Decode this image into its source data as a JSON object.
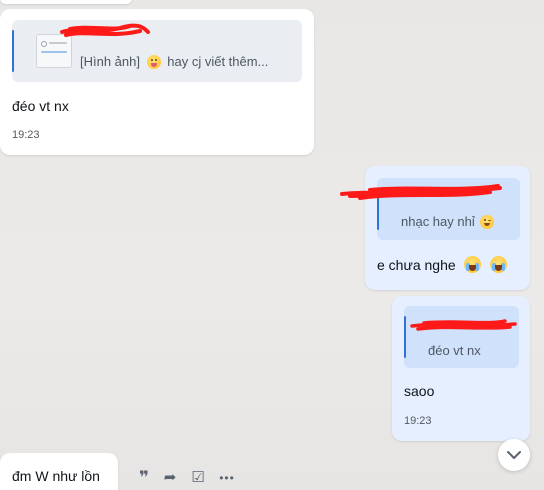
{
  "messages": {
    "m1": {
      "quote_text": "[Hình ảnh]",
      "quote_rest": "hay cj viết thêm...",
      "text": "đéo vt nx",
      "time": "19:23"
    },
    "m2": {
      "quote_text": "nhạc hay nhỉ",
      "text": "e chưa nghe"
    },
    "m3": {
      "quote_text": "đéo vt nx",
      "text": "saoo",
      "time": "19:23"
    },
    "m4": {
      "text": "đm W như lồn"
    }
  },
  "actions": [
    {
      "name": "quote-icon",
      "glyph": "❞"
    },
    {
      "name": "forward-icon",
      "glyph": "➦"
    },
    {
      "name": "task-icon",
      "glyph": "☑"
    },
    {
      "name": "more-icon",
      "glyph": "•••"
    }
  ],
  "colors": {
    "incoming_bubble": "#ffffff",
    "outgoing_bubble": "#e5efff",
    "accent": "#2f73d9",
    "scribble": "#ff1a1a"
  }
}
